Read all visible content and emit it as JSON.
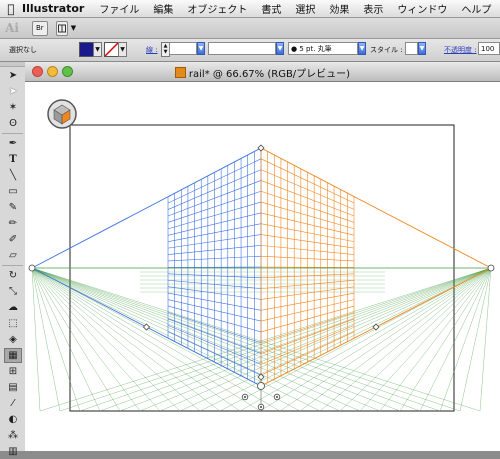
{
  "menubar": {
    "app_name": "Illustrator",
    "items": [
      "ファイル",
      "編集",
      "オブジェクト",
      "書式",
      "選択",
      "効果",
      "表示",
      "ウィンドウ",
      "ヘルプ"
    ]
  },
  "appbar": {
    "logo": "Ai",
    "bridge_label": "Br"
  },
  "controlbar": {
    "selection_status": "選択なし",
    "stroke_label": "線 :",
    "brush_value": "5 pt. 丸筆",
    "style_label": "スタイル :",
    "opacity_label": "不透明度 :",
    "opacity_value": "100",
    "fill_color": "#1a1a8c"
  },
  "document": {
    "title": "rail* @ 66.67% (RGB/プレビュー)"
  },
  "colors": {
    "grid_left": "#3f73e0",
    "grid_right": "#f0861e",
    "grid_ground": "#3f9a3f",
    "close_button": "#ef5d55",
    "minimize_button": "#f2bb3a",
    "zoom_button": "#5fc148"
  },
  "toolbox": {
    "tools": [
      "selection-arrow-icon",
      "direct-selection-icon",
      "magic-wand-icon",
      "lasso-icon",
      "pen-icon",
      "type-icon",
      "line-icon",
      "rectangle-icon",
      "paintbrush-icon",
      "pencil-icon",
      "blob-brush-icon",
      "eraser-icon",
      "rotate-icon",
      "scale-icon",
      "warp-icon",
      "free-transform-icon",
      "shape-builder-icon",
      "perspective-grid-icon",
      "mesh-icon",
      "gradient-icon",
      "eyedropper-icon",
      "blend-icon",
      "symbol-sprayer-icon",
      "column-graph-icon"
    ]
  }
}
